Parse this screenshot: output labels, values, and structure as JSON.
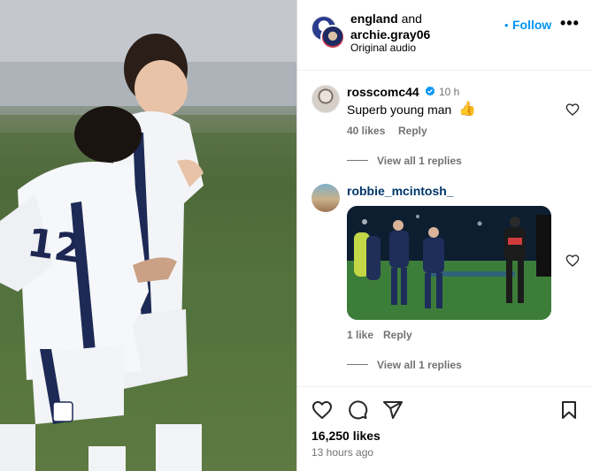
{
  "header": {
    "account_1": "england",
    "joiner": "and",
    "account_2": "archie.gray06",
    "audio": "Original audio",
    "separator": "•",
    "follow_label": "Follow",
    "more_label": "•••"
  },
  "comments": [
    {
      "username": "rosscomc44",
      "time": "10 h",
      "text": "Superb young man",
      "emoji": "👍",
      "likes": "40 likes",
      "reply_label": "Reply",
      "view_replies": "View all 1 replies"
    },
    {
      "username": "robbie_mcintosh_",
      "likes": "1 like",
      "reply_label": "Reply",
      "view_replies": "View all 1 replies"
    }
  ],
  "footer": {
    "likes": "16,250 likes",
    "posted": "13 hours ago"
  },
  "icons": {
    "like": "heart-icon",
    "comment": "comment-icon",
    "share": "share-icon",
    "save": "bookmark-icon",
    "verified": "verified-badge-icon",
    "comment_like": "heart-icon"
  },
  "colors": {
    "accent": "#0095f6",
    "muted": "#737373",
    "username_link": "#00376b"
  }
}
